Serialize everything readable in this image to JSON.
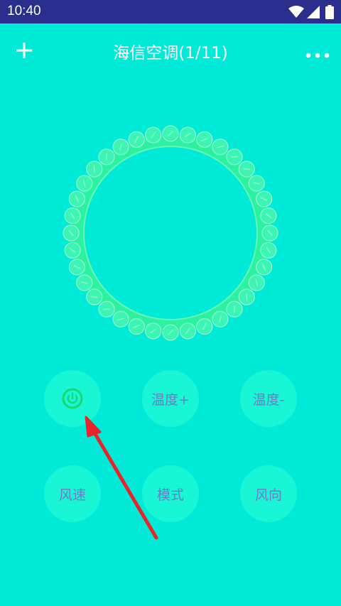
{
  "status_bar": {
    "time": "10:40",
    "icons": [
      "wifi-icon",
      "signal-icon",
      "battery-icon"
    ]
  },
  "header": {
    "title": "海信空调(1/11)",
    "add_icon": "plus-icon",
    "more_icon": "more-dots-icon"
  },
  "display": {
    "ring_icon": "decorative-ring"
  },
  "remote": {
    "power_icon": "power-icon",
    "temp_up": "温度+",
    "temp_down": "温度-",
    "fan_speed": "风速",
    "mode": "模式",
    "fan_direction": "风向"
  },
  "colors": {
    "background": "#00EAD8",
    "status_bar": "#2A2F8E",
    "button_fill": "#18F6D6",
    "button_text": "#6E7CC6",
    "power_icon": "#19D96E",
    "ring": "#2AF2A0",
    "annotation_arrow": "#E8242B"
  },
  "annotation": {
    "type": "arrow",
    "points_to": "power-button"
  }
}
